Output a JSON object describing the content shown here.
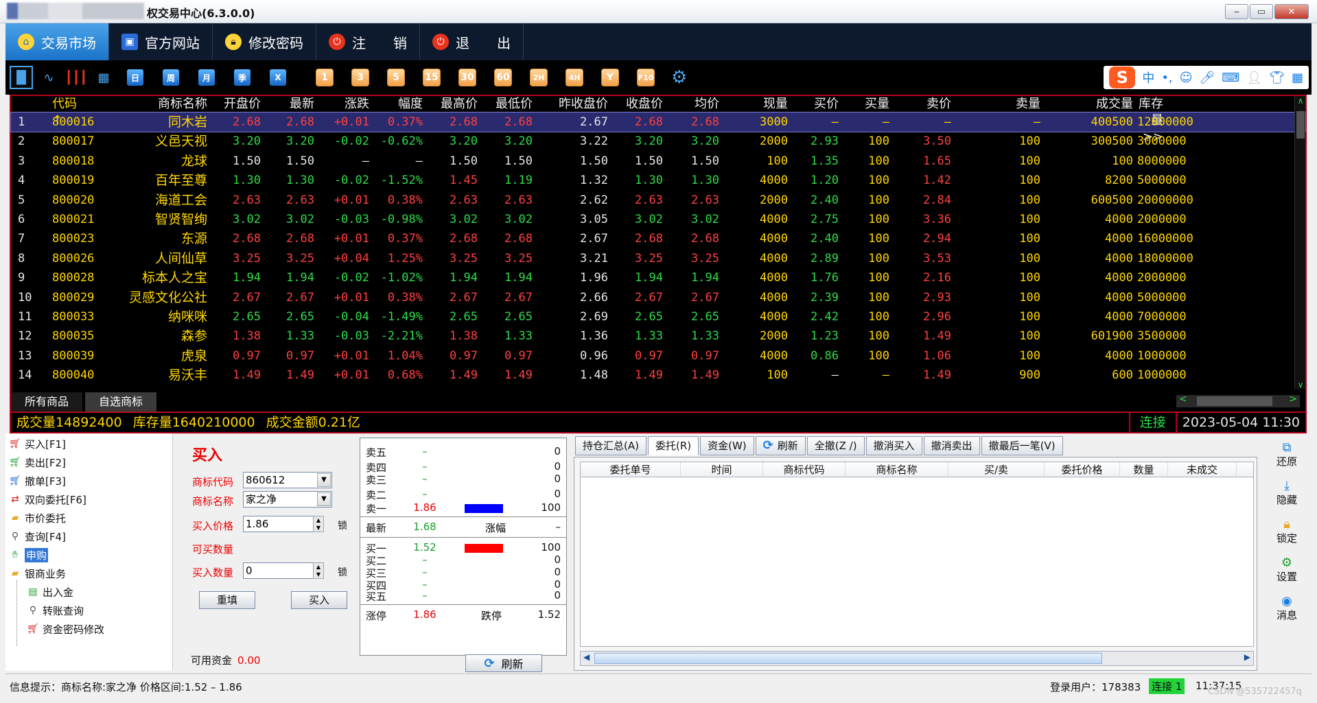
{
  "window": {
    "title": "权交易中心(6.3.0.0)",
    "btn_min": "‒",
    "btn_max": "▭",
    "btn_close": "✕"
  },
  "menu": [
    {
      "label": "交易市场",
      "icon": "home-icon"
    },
    {
      "label": "官方网站",
      "icon": "website-icon"
    },
    {
      "label": "修改密码",
      "icon": "lock-icon"
    },
    {
      "label": "注　　销",
      "icon": "power-icon"
    },
    {
      "label": "退　　出",
      "icon": "power-icon"
    }
  ],
  "toolbar": {
    "blue": [
      "日",
      "周",
      "月",
      "季",
      "X"
    ],
    "orange": [
      "1",
      "3",
      "5",
      "15",
      "30",
      "60",
      "2H",
      "4H",
      "Y",
      "F10"
    ]
  },
  "ime": {
    "logo": "S",
    "mode": "中",
    "punct": "•,"
  },
  "quote": {
    "headers": [
      "",
      "代码↑",
      "商标名称",
      "开盘价",
      "最新",
      "涨跌",
      "幅度",
      "最高价",
      "最低价",
      "昨收盘价",
      "收盘价",
      "均价",
      "现量",
      "买价",
      "买量",
      "卖价",
      "卖量",
      "成交量",
      "库存量 >>"
    ],
    "rows": [
      {
        "i": "1",
        "code": "800016",
        "name": "同木岩",
        "open": "2.68",
        "last": "2.68",
        "chg": "+0.01",
        "pct": "0.37%",
        "high": "2.68",
        "low": "2.68",
        "prev": "2.67",
        "close": "2.68",
        "avg": "2.68",
        "cur": "3000",
        "bid": "—",
        "bidv": "—",
        "ask": "—",
        "askv": "—",
        "vol": "400500",
        "stock": "12000000",
        "dir": "up"
      },
      {
        "i": "2",
        "code": "800017",
        "name": "义邑天视",
        "open": "3.20",
        "last": "3.20",
        "chg": "-0.02",
        "pct": "-0.62%",
        "high": "3.20",
        "low": "3.20",
        "prev": "3.22",
        "close": "3.20",
        "avg": "3.20",
        "cur": "2000",
        "bid": "2.93",
        "bidv": "100",
        "ask": "3.50",
        "askv": "100",
        "vol": "300500",
        "stock": "3000000",
        "dir": "down"
      },
      {
        "i": "3",
        "code": "800018",
        "name": "龙球",
        "open": "1.50",
        "last": "1.50",
        "chg": "—",
        "pct": "—",
        "high": "1.50",
        "low": "1.50",
        "prev": "1.50",
        "close": "1.50",
        "avg": "1.50",
        "cur": "100",
        "bid": "1.35",
        "bidv": "100",
        "ask": "1.65",
        "askv": "100",
        "vol": "100",
        "stock": "8000000",
        "dir": "flat"
      },
      {
        "i": "4",
        "code": "800019",
        "name": "百年至尊",
        "open": "1.30",
        "last": "1.30",
        "chg": "-0.02",
        "pct": "-1.52%",
        "high": "1.45",
        "low": "1.19",
        "prev": "1.32",
        "close": "1.30",
        "avg": "1.30",
        "cur": "4000",
        "bid": "1.20",
        "bidv": "100",
        "ask": "1.42",
        "askv": "100",
        "vol": "8200",
        "stock": "5000000",
        "dir": "down",
        "hdir": "up",
        "ldir": "down"
      },
      {
        "i": "5",
        "code": "800020",
        "name": "海道工会",
        "open": "2.63",
        "last": "2.63",
        "chg": "+0.01",
        "pct": "0.38%",
        "high": "2.63",
        "low": "2.63",
        "prev": "2.62",
        "close": "2.63",
        "avg": "2.63",
        "cur": "2000",
        "bid": "2.40",
        "bidv": "100",
        "ask": "2.84",
        "askv": "100",
        "vol": "600500",
        "stock": "20000000",
        "dir": "up"
      },
      {
        "i": "6",
        "code": "800021",
        "name": "智贤智绚",
        "open": "3.02",
        "last": "3.02",
        "chg": "-0.03",
        "pct": "-0.98%",
        "high": "3.02",
        "low": "3.02",
        "prev": "3.05",
        "close": "3.02",
        "avg": "3.02",
        "cur": "4000",
        "bid": "2.75",
        "bidv": "100",
        "ask": "3.36",
        "askv": "100",
        "vol": "4000",
        "stock": "2000000",
        "dir": "down"
      },
      {
        "i": "7",
        "code": "800023",
        "name": "东源",
        "open": "2.68",
        "last": "2.68",
        "chg": "+0.01",
        "pct": "0.37%",
        "high": "2.68",
        "low": "2.68",
        "prev": "2.67",
        "close": "2.68",
        "avg": "2.68",
        "cur": "4000",
        "bid": "2.40",
        "bidv": "100",
        "ask": "2.94",
        "askv": "100",
        "vol": "4000",
        "stock": "16000000",
        "dir": "up"
      },
      {
        "i": "8",
        "code": "800026",
        "name": "人间仙草",
        "open": "3.25",
        "last": "3.25",
        "chg": "+0.04",
        "pct": "1.25%",
        "high": "3.25",
        "low": "3.25",
        "prev": "3.21",
        "close": "3.25",
        "avg": "3.25",
        "cur": "4000",
        "bid": "2.89",
        "bidv": "100",
        "ask": "3.53",
        "askv": "100",
        "vol": "4000",
        "stock": "18000000",
        "dir": "up"
      },
      {
        "i": "9",
        "code": "800028",
        "name": "标本人之宝",
        "open": "1.94",
        "last": "1.94",
        "chg": "-0.02",
        "pct": "-1.02%",
        "high": "1.94",
        "low": "1.94",
        "prev": "1.96",
        "close": "1.94",
        "avg": "1.94",
        "cur": "4000",
        "bid": "1.76",
        "bidv": "100",
        "ask": "2.16",
        "askv": "100",
        "vol": "4000",
        "stock": "2000000",
        "dir": "down"
      },
      {
        "i": "10",
        "code": "800029",
        "name": "灵感文化公社",
        "open": "2.67",
        "last": "2.67",
        "chg": "+0.01",
        "pct": "0.38%",
        "high": "2.67",
        "low": "2.67",
        "prev": "2.66",
        "close": "2.67",
        "avg": "2.67",
        "cur": "4000",
        "bid": "2.39",
        "bidv": "100",
        "ask": "2.93",
        "askv": "100",
        "vol": "4000",
        "stock": "5000000",
        "dir": "up"
      },
      {
        "i": "11",
        "code": "800033",
        "name": "纳咪咪",
        "open": "2.65",
        "last": "2.65",
        "chg": "-0.04",
        "pct": "-1.49%",
        "high": "2.65",
        "low": "2.65",
        "prev": "2.69",
        "close": "2.65",
        "avg": "2.65",
        "cur": "4000",
        "bid": "2.42",
        "bidv": "100",
        "ask": "2.96",
        "askv": "100",
        "vol": "4000",
        "stock": "7000000",
        "dir": "down"
      },
      {
        "i": "12",
        "code": "800035",
        "name": "森参",
        "open": "1.38",
        "last": "1.33",
        "chg": "-0.03",
        "pct": "-2.21%",
        "high": "1.38",
        "low": "1.33",
        "prev": "1.36",
        "close": "1.33",
        "avg": "1.33",
        "cur": "2000",
        "bid": "1.23",
        "bidv": "100",
        "ask": "1.49",
        "askv": "100",
        "vol": "601900",
        "stock": "3500000",
        "dir": "down",
        "odir": "up",
        "hdir": "up"
      },
      {
        "i": "13",
        "code": "800039",
        "name": "虎泉",
        "open": "0.97",
        "last": "0.97",
        "chg": "+0.01",
        "pct": "1.04%",
        "high": "0.97",
        "low": "0.97",
        "prev": "0.96",
        "close": "0.97",
        "avg": "0.97",
        "cur": "4000",
        "bid": "0.86",
        "bidv": "100",
        "ask": "1.06",
        "askv": "100",
        "vol": "4000",
        "stock": "1000000",
        "dir": "up"
      },
      {
        "i": "14",
        "code": "800040",
        "name": "易沃丰",
        "open": "1.49",
        "last": "1.49",
        "chg": "+0.01",
        "pct": "0.68%",
        "high": "1.49",
        "low": "1.49",
        "prev": "1.48",
        "close": "1.49",
        "avg": "1.49",
        "cur": "100",
        "bid": "—",
        "bidv": "—",
        "ask": "1.49",
        "askv": "900",
        "vol": "600",
        "stock": "1000000",
        "dir": "up"
      }
    ],
    "tabs": [
      "所有商品",
      "自选商标"
    ]
  },
  "market_status": {
    "volume": "成交量14892400",
    "stock": "库存量1640210000",
    "amount": "成交金额0.21亿",
    "conn": "连接",
    "datetime": "2023-05-04 11:30"
  },
  "tree": {
    "items": [
      {
        "label": "买入[F1]"
      },
      {
        "label": "卖出[F2]"
      },
      {
        "label": "撤单[F3]"
      },
      {
        "label": "双向委托[F6]"
      },
      {
        "label": "市价委托"
      },
      {
        "label": "查询[F4]"
      },
      {
        "label": "申购"
      },
      {
        "label": "银商业务"
      }
    ],
    "sub": [
      {
        "label": "出入金"
      },
      {
        "label": "转账查询"
      },
      {
        "label": "资金密码修改"
      }
    ]
  },
  "buy_form": {
    "title": "买入",
    "code_label": "商标代码",
    "code_value": "860612",
    "name_label": "商标名称",
    "name_value": "家之净",
    "price_label": "买入价格",
    "price_value": "1.86",
    "avail_qty_label": "可买数量",
    "qty_label": "买入数量",
    "qty_value": "0",
    "lock": "锁",
    "reset": "重填",
    "buy": "买入",
    "funds_label": "可用资金",
    "funds_value": "0.00"
  },
  "depth": {
    "sell": [
      {
        "label": "卖五",
        "price": "–",
        "vol": "0"
      },
      {
        "label": "卖四",
        "price": "–",
        "vol": "0"
      },
      {
        "label": "卖三",
        "price": "–",
        "vol": "0"
      },
      {
        "label": "卖二",
        "price": "–",
        "vol": "0"
      },
      {
        "label": "卖一",
        "price": "1.86",
        "vol": "100"
      }
    ],
    "last_label": "最新",
    "last_value": "1.68",
    "pct_label": "涨幅",
    "pct_value": "–",
    "buy": [
      {
        "label": "买一",
        "price": "1.52",
        "vol": "100"
      },
      {
        "label": "买二",
        "price": "–",
        "vol": "0"
      },
      {
        "label": "买三",
        "price": "–",
        "vol": "0"
      },
      {
        "label": "买四",
        "price": "–",
        "vol": "0"
      },
      {
        "label": "买五",
        "price": "–",
        "vol": "0"
      }
    ],
    "limit_up_label": "涨停",
    "limit_up": "1.86",
    "limit_down_label": "跌停",
    "limit_down": "1.52",
    "refresh": "刷新",
    "colors": {
      "sell_bar": "#0000ff",
      "buy_bar": "#ff0000"
    }
  },
  "orders": {
    "tabs": [
      "持仓汇总(A)",
      "委托(R)",
      "资金(W)",
      "刷新",
      "全撤(Z /)",
      "撤消买入",
      "撤消卖出",
      "撤最后一笔(V)"
    ],
    "headers": [
      "委托单号",
      "时间",
      "商标代码",
      "商标名称",
      "买/卖",
      "委托价格",
      "数量",
      "未成交"
    ]
  },
  "right_panel": [
    {
      "label": "还原",
      "icon": "restore-icon"
    },
    {
      "label": "隐藏",
      "icon": "hide-icon"
    },
    {
      "label": "锁定",
      "icon": "lock-icon"
    },
    {
      "label": "设置",
      "icon": "gear-icon"
    },
    {
      "label": "消息",
      "icon": "message-icon"
    }
  ],
  "status": {
    "info": "信息提示：商标名称:家之净  价格区间:1.52 – 1.86",
    "user": "登录用户：178383",
    "conn": "连接 1",
    "clock": "11:37:15",
    "watermark": "CSDN @535722457q"
  }
}
